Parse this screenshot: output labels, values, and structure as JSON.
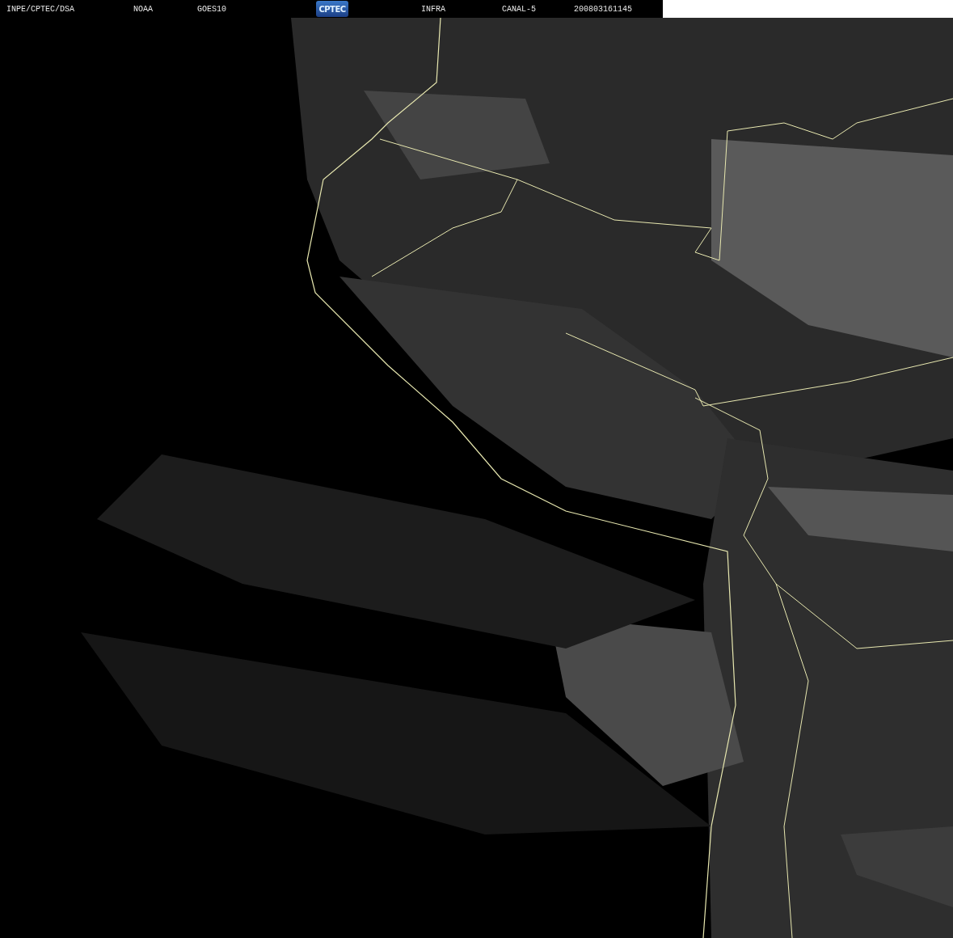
{
  "header": {
    "items": [
      {
        "kind": "text",
        "text": "INPE/CPTEC/DSA"
      },
      {
        "kind": "text",
        "text": "NOAA"
      },
      {
        "kind": "text",
        "text": "GOES10"
      },
      {
        "kind": "logo",
        "text": "CPTEC"
      },
      {
        "kind": "text",
        "text": "INFRA"
      },
      {
        "kind": "text",
        "text": "CANAL-5"
      },
      {
        "kind": "text",
        "text": "200803161145"
      }
    ]
  }
}
